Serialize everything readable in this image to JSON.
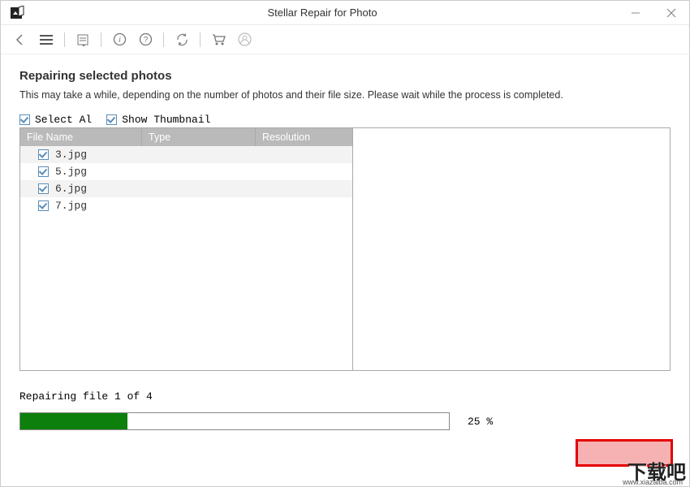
{
  "titlebar": {
    "title": "Stellar Repair for Photo"
  },
  "content": {
    "heading": "Repairing selected photos",
    "sub": "This may take a while, depending on the number of photos and their file size. Please wait while the process is completed.",
    "select_all_label": "Select Al",
    "show_thumb_label": "Show Thumbnail"
  },
  "columns": {
    "name": "File Name",
    "type": "Type",
    "res": "Resolution"
  },
  "files": [
    {
      "name": "3.jpg",
      "checked": true
    },
    {
      "name": "5.jpg",
      "checked": true
    },
    {
      "name": "6.jpg",
      "checked": true
    },
    {
      "name": "7.jpg",
      "checked": true
    }
  ],
  "progress": {
    "status": "Repairing file 1 of 4",
    "percent_text": "25 %",
    "percent": 25
  },
  "watermark": {
    "text": "下载吧",
    "url": "www.xiazaiba.com"
  }
}
